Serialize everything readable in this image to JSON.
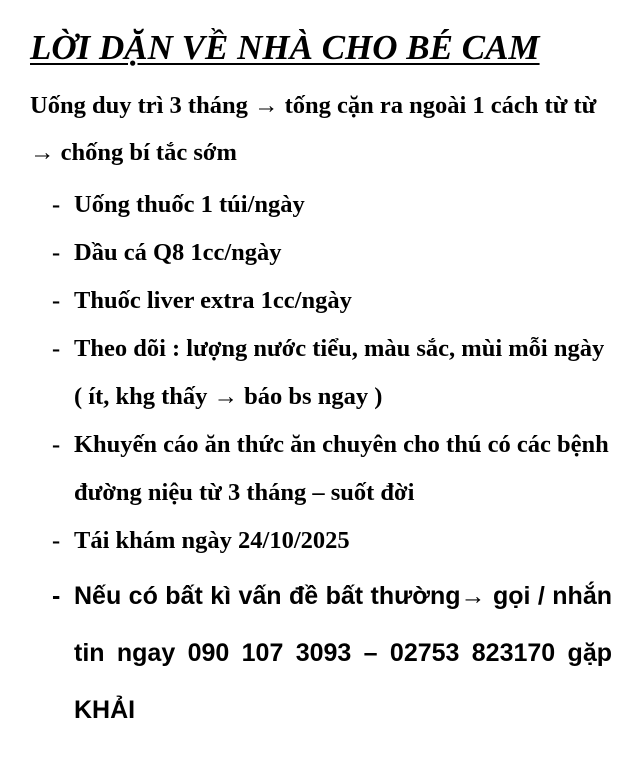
{
  "title": "LỜI DẶN VỀ NHÀ CHO BÉ CAM",
  "intro": "Uống duy trì 3 tháng → tống cặn ra ngoài 1 cách từ từ → chống bí tắc sớm",
  "bullet_marker": "-",
  "items": [
    "Uống thuốc 1 túi/ngày",
    "Dầu cá Q8 1cc/ngày",
    "Thuốc liver extra 1cc/ngày",
    "Theo dõi : lượng nước tiểu, màu sắc, mùi mỗi ngày ( ít, khg thấy → báo bs ngay )",
    "Khuyến cáo ăn thức ăn chuyên cho thú có các bệnh đường niệu từ 3 tháng – suốt đời",
    "Tái khám ngày 24/10/2025",
    "Nếu có bất kì vấn đề bất thường→ gọi / nhắn tin ngay 090 107 3093 – 02753 823170 gặp KHẢI"
  ]
}
